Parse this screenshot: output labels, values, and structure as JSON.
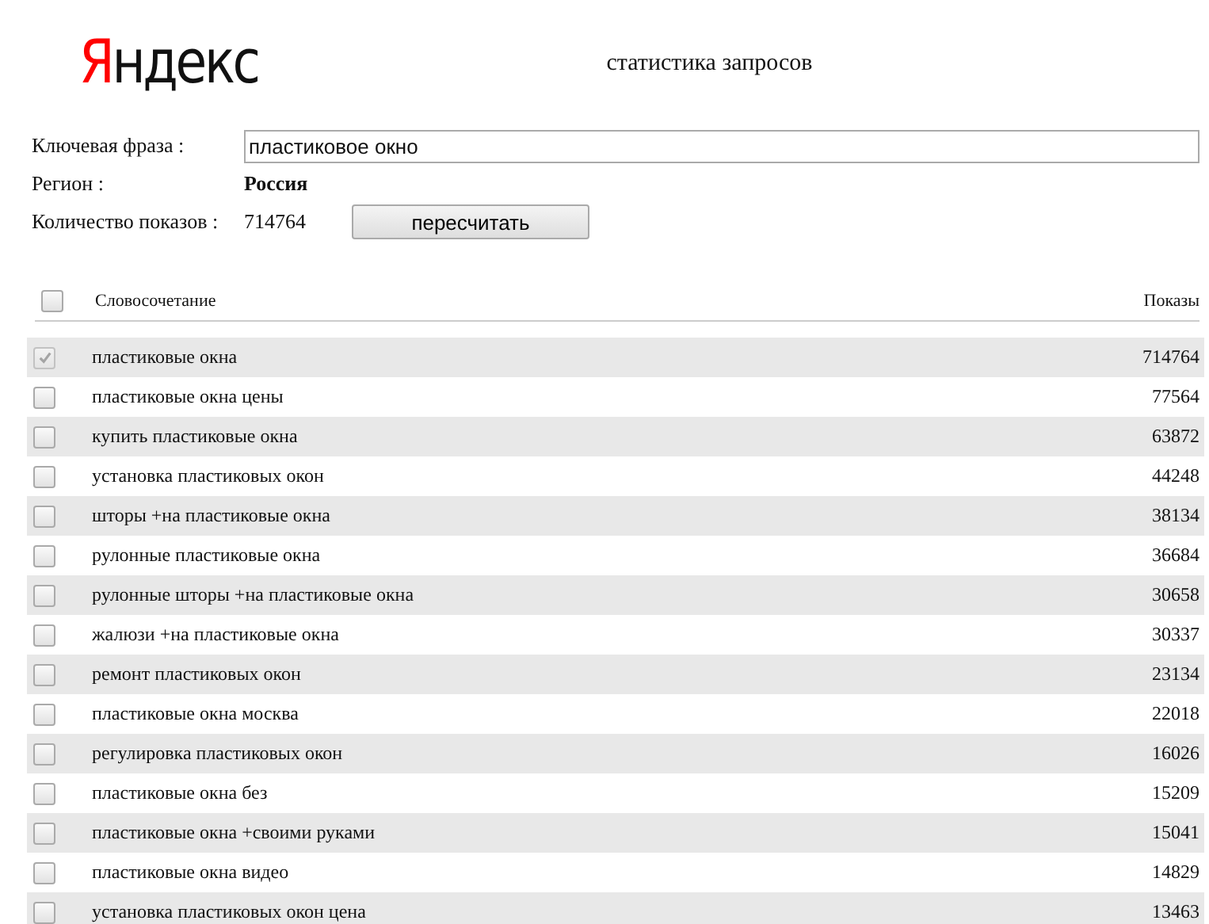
{
  "logo": {
    "first_letter": "Я",
    "rest": "ндекс"
  },
  "title": "статистика запросов",
  "form": {
    "phrase_label": "Ключевая фраза :",
    "phrase_value": "пластиковое окно",
    "region_label": "Регион :",
    "region_value": "Россия",
    "count_label": "Количество показов :",
    "count_value": "714764",
    "recalc_button": "пересчитать"
  },
  "table": {
    "columns": [
      "Словосочетание",
      "Показы"
    ],
    "header_checked": false,
    "rows": [
      {
        "phrase": "пластиковые окна",
        "shows": "714764",
        "checked": true,
        "disabled": true
      },
      {
        "phrase": "пластиковые окна цены",
        "shows": "77564",
        "checked": false,
        "disabled": false
      },
      {
        "phrase": "купить пластиковые окна",
        "shows": "63872",
        "checked": false,
        "disabled": false
      },
      {
        "phrase": "установка пластиковых окон",
        "shows": "44248",
        "checked": false,
        "disabled": false
      },
      {
        "phrase": "шторы +на пластиковые окна",
        "shows": "38134",
        "checked": false,
        "disabled": false
      },
      {
        "phrase": "рулонные пластиковые окна",
        "shows": "36684",
        "checked": false,
        "disabled": false
      },
      {
        "phrase": "рулонные шторы +на пластиковые окна",
        "shows": "30658",
        "checked": false,
        "disabled": false
      },
      {
        "phrase": "жалюзи +на пластиковые окна",
        "shows": "30337",
        "checked": false,
        "disabled": false
      },
      {
        "phrase": "ремонт пластиковых окон",
        "shows": "23134",
        "checked": false,
        "disabled": false
      },
      {
        "phrase": "пластиковые окна москва",
        "shows": "22018",
        "checked": false,
        "disabled": false
      },
      {
        "phrase": "регулировка пластиковых окон",
        "shows": "16026",
        "checked": false,
        "disabled": false
      },
      {
        "phrase": "пластиковые окна без",
        "shows": "15209",
        "checked": false,
        "disabled": false
      },
      {
        "phrase": "пластиковые окна +своими руками",
        "shows": "15041",
        "checked": false,
        "disabled": false
      },
      {
        "phrase": "пластиковые окна видео",
        "shows": "14829",
        "checked": false,
        "disabled": false
      },
      {
        "phrase": "установка пластиковых окон цена",
        "shows": "13463",
        "checked": false,
        "disabled": false
      }
    ]
  }
}
